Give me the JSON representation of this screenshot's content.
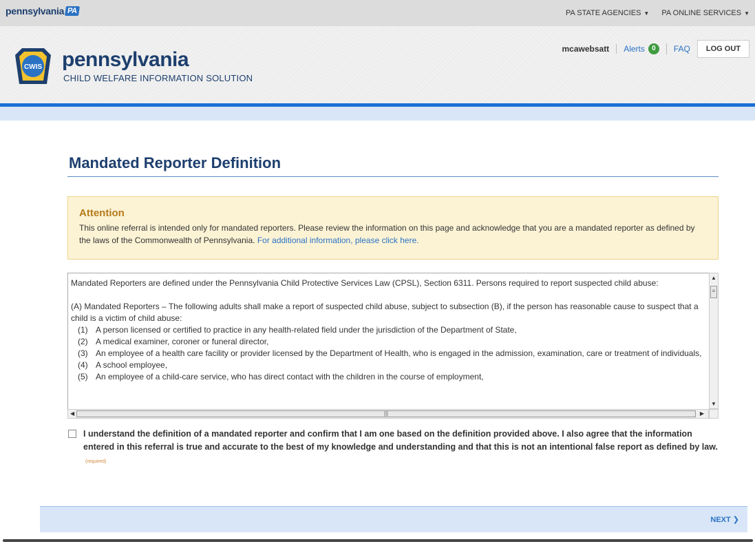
{
  "state_bar": {
    "logo_text": "pennsylvania",
    "logo_badge": "PA",
    "menu": [
      "PA STATE AGENCIES",
      "PA ONLINE SERVICES"
    ]
  },
  "header": {
    "keystone_text": "CWIS",
    "title": "pennsylvania",
    "subtitle": "CHILD WELFARE INFORMATION SOLUTION",
    "username": "mcawebsatt",
    "alerts_label": "Alerts",
    "alerts_count": "0",
    "faq_label": "FAQ",
    "logout_label": "LOG OUT"
  },
  "page": {
    "title": "Mandated Reporter Definition"
  },
  "attention": {
    "heading": "Attention",
    "body": "This online referral is intended only for mandated reporters. Please review the information on this page and acknowledge that you are a mandated reporter as defined by the laws of the Commonwealth of Pennsylvania. ",
    "link": "For additional information, please click here."
  },
  "definition": {
    "intro": "Mandated Reporters are defined under the Pennsylvania Child Protective Services Law (CPSL), Section 6311. Persons required to report suspected child abuse:",
    "section_a": "(A) Mandated Reporters – The following adults shall make a report of suspected child abuse, subject to subsection (B), if the person has reasonable cause to suspect that a child is a victim of child abuse:",
    "items": [
      {
        "num": "(1)",
        "text": "A person licensed or certified to practice in any health-related field under the jurisdiction of the Department of State,"
      },
      {
        "num": "(2)",
        "text": "A medical examiner, coroner or funeral director,"
      },
      {
        "num": "(3)",
        "text": "An employee of a health care facility or provider licensed by the Department of Health, who is engaged in the admission, examination, care or treatment of individuals,"
      },
      {
        "num": "(4)",
        "text": "A school employee,"
      },
      {
        "num": "(5)",
        "text": "An employee of a child-care service, who has direct contact with the children in the course of employment,"
      }
    ]
  },
  "confirm": {
    "text": "I understand the definition of a mandated reporter and confirm that I am one based on the definition provided above. I also agree that the information entered in this referral is true and accurate to the best of my knowledge and understanding and that this is not an intentional false report as defined by law.",
    "required": "(required)"
  },
  "footer": {
    "next_label": "NEXT"
  }
}
